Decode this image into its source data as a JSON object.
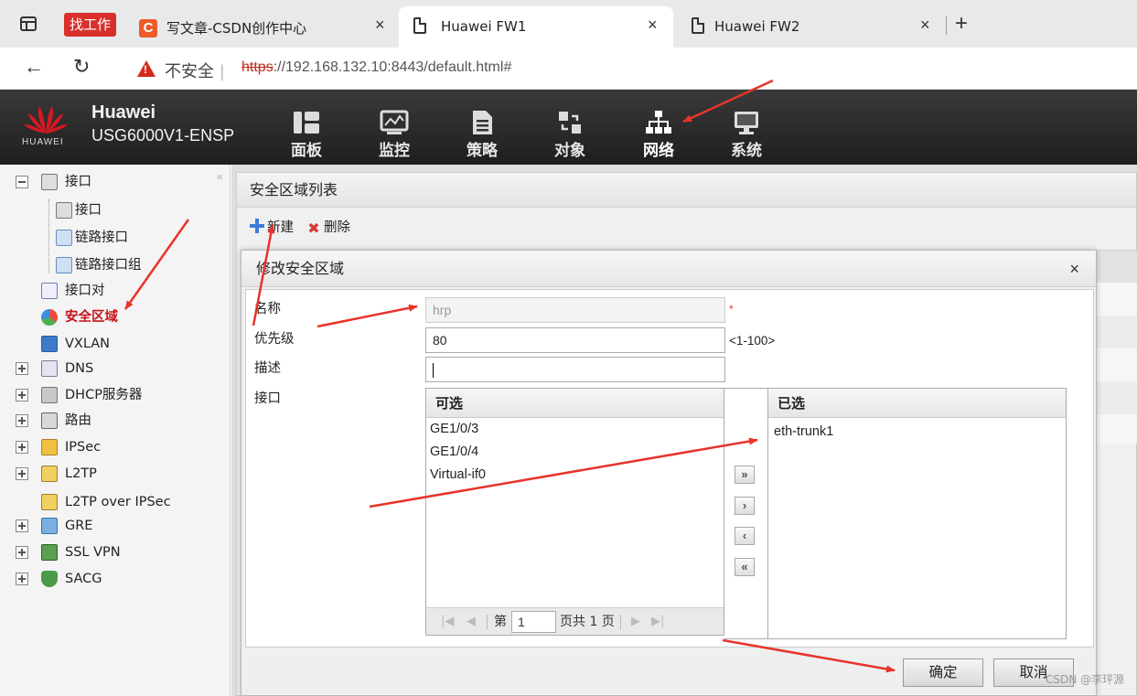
{
  "browser": {
    "pinned_label": "找工作",
    "tabs": [
      {
        "title": "写文章-CSDN创作中心",
        "icon": "csdn-icon",
        "icon_glyph": "C"
      },
      {
        "title": "Huawei FW1",
        "icon": "page-icon",
        "active": true
      },
      {
        "title": "Huawei FW2",
        "icon": "page-icon"
      }
    ],
    "close_glyph": "×",
    "new_tab_glyph": "+",
    "back_glyph": "←",
    "reload_glyph": "↻",
    "security_label": "不安全",
    "url_scheme": "https",
    "url_rest": "://192.168.132.10:8443/default.html#"
  },
  "header": {
    "brand": "Huawei",
    "model": "USG6000V1-ENSP",
    "logo_text": "HUAWEI",
    "nav": [
      {
        "label": "面板",
        "icon": "dashboard-icon"
      },
      {
        "label": "监控",
        "icon": "monitor-icon"
      },
      {
        "label": "策略",
        "icon": "policy-icon"
      },
      {
        "label": "对象",
        "icon": "object-icon"
      },
      {
        "label": "网络",
        "icon": "network-icon",
        "active": true
      },
      {
        "label": "系统",
        "icon": "system-icon"
      }
    ]
  },
  "sidebar": {
    "collapse_glyph": "«",
    "items": [
      {
        "label": "接口",
        "expander": "minus"
      },
      {
        "label": "接口"
      },
      {
        "label": "链路接口"
      },
      {
        "label": "链路接口组"
      },
      {
        "label": "接口对"
      },
      {
        "label": "安全区域",
        "selected": true
      },
      {
        "label": "VXLAN"
      },
      {
        "label": "DNS",
        "expander": "plus"
      },
      {
        "label": "DHCP服务器",
        "expander": "plus"
      },
      {
        "label": "路由",
        "expander": "plus"
      },
      {
        "label": "IPSec",
        "expander": "plus"
      },
      {
        "label": "L2TP",
        "expander": "plus"
      },
      {
        "label": "L2TP over IPSec"
      },
      {
        "label": "GRE",
        "expander": "plus"
      },
      {
        "label": "SSL VPN",
        "expander": "plus"
      },
      {
        "label": "SACG",
        "expander": "plus"
      }
    ]
  },
  "main": {
    "list_title": "安全区域列表",
    "toolbar": {
      "new_label": "新建",
      "delete_label": "删除"
    }
  },
  "dialog": {
    "title": "修改安全区域",
    "close_glyph": "×",
    "fields": {
      "name_label": "名称",
      "name_value": "hrp",
      "required_mark": "*",
      "priority_label": "优先级",
      "priority_value": "80",
      "priority_range": "<1-100>",
      "desc_label": "描述",
      "desc_value": "",
      "interface_label": "接口"
    },
    "available": {
      "header": "可选",
      "items": [
        "GE1/0/3",
        "GE1/0/4",
        "Virtual-if0"
      ]
    },
    "selected": {
      "header": "已选",
      "items": [
        "eth-trunk1"
      ]
    },
    "move_buttons": [
      "»",
      "›",
      "‹",
      "«"
    ],
    "pager": {
      "first": "|◀",
      "prev": "◀",
      "next": "▶",
      "last": "▶|",
      "page_prefix": "第",
      "page_value": "1",
      "page_suffix": "页共 1 页"
    },
    "ok_label": "确定",
    "cancel_label": "取消"
  },
  "watermark": "CSDN @李玶源",
  "annotation_color": "#e8332b"
}
